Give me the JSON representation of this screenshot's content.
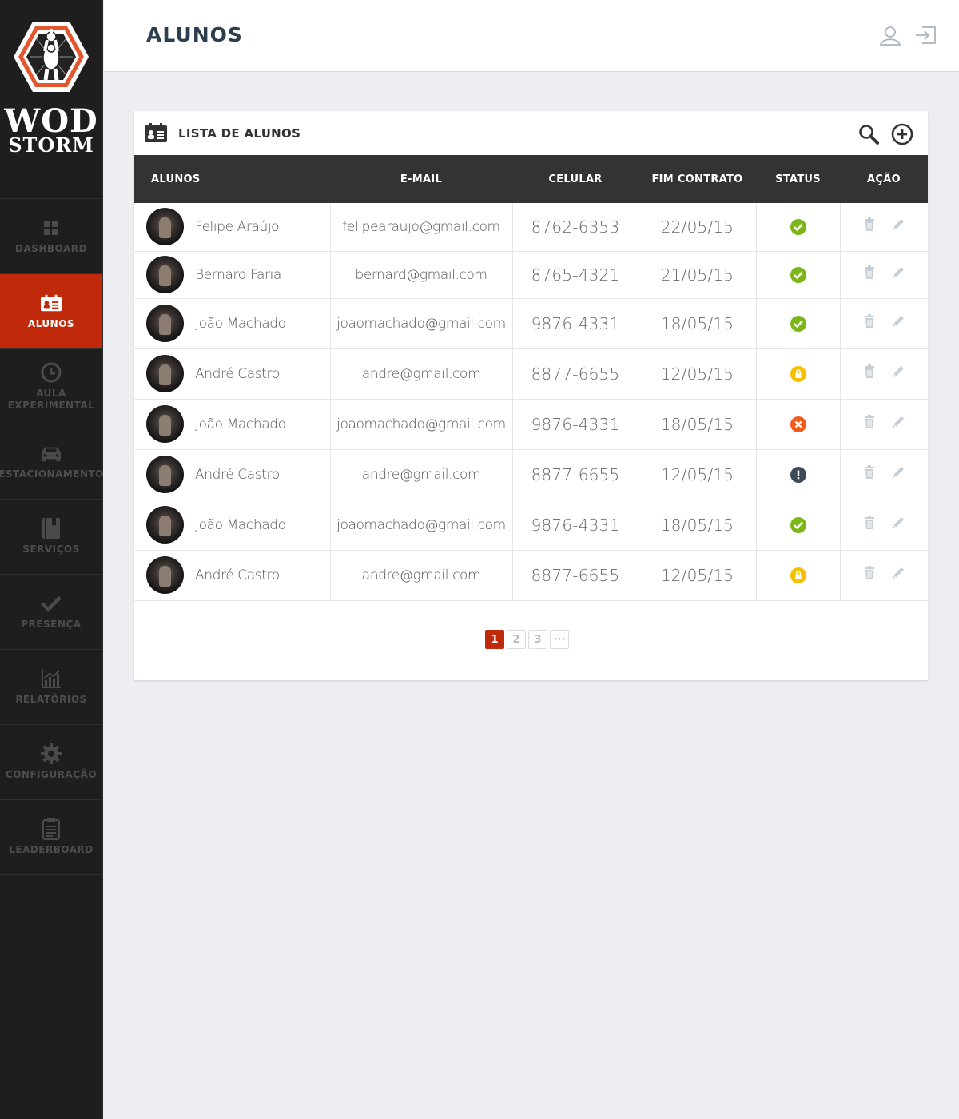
{
  "brand": {
    "line1": "WOD",
    "line2": "STORM"
  },
  "sidebar": {
    "items": [
      {
        "label": "DASHBOARD",
        "icon": "grid-icon"
      },
      {
        "label": "ALUNOS",
        "icon": "id-card-icon",
        "active": true
      },
      {
        "label": "AULA EXPERIMENTAL",
        "icon": "clock-icon"
      },
      {
        "label": "ESTACIONAMENTO",
        "icon": "car-icon"
      },
      {
        "label": "SERVIÇOS",
        "icon": "book-icon"
      },
      {
        "label": "PRESENÇA",
        "icon": "check-icon"
      },
      {
        "label": "RELATÓRIOS",
        "icon": "chart-icon"
      },
      {
        "label": "CONFIGURAÇÃO",
        "icon": "gear-icon"
      },
      {
        "label": "LEADERBOARD",
        "icon": "clipboard-icon"
      }
    ]
  },
  "header": {
    "title": "ALUNOS"
  },
  "card": {
    "title": "LISTA DE ALUNOS"
  },
  "table": {
    "columns": [
      "ALUNOS",
      "E-MAIL",
      "CELULAR",
      "FIM CONTRATO",
      "STATUS",
      "AÇÃO"
    ],
    "rows": [
      {
        "name": "Felipe Araújo",
        "email": "felipearaujo@gmail.com",
        "phone": "8762-6353",
        "end": "22/05/15",
        "status": "ok"
      },
      {
        "name": "Bernard Faria",
        "email": "bernard@gmail.com",
        "phone": "8765-4321",
        "end": "21/05/15",
        "status": "ok"
      },
      {
        "name": "João Machado",
        "email": "joaomachado@gmail.com",
        "phone": "9876-4331",
        "end": "18/05/15",
        "status": "ok"
      },
      {
        "name": "André Castro",
        "email": "andre@gmail.com",
        "phone": "8877-6655",
        "end": "12/05/15",
        "status": "locked"
      },
      {
        "name": "João Machado",
        "email": "joaomachado@gmail.com",
        "phone": "9876-4331",
        "end": "18/05/15",
        "status": "cancelled"
      },
      {
        "name": "André Castro",
        "email": "andre@gmail.com",
        "phone": "8877-6655",
        "end": "12/05/15",
        "status": "warning"
      },
      {
        "name": "João Machado",
        "email": "joaomachado@gmail.com",
        "phone": "9876-4331",
        "end": "18/05/15",
        "status": "ok"
      },
      {
        "name": "André Castro",
        "email": "andre@gmail.com",
        "phone": "8877-6655",
        "end": "12/05/15",
        "status": "locked"
      }
    ]
  },
  "pagination": {
    "pages": [
      "1",
      "2",
      "3",
      "···"
    ],
    "current": "1"
  },
  "colors": {
    "accent": "#c1290b",
    "ok": "#7cb518",
    "locked": "#f5c000",
    "cancelled": "#f05a1a",
    "warning": "#3d4a57"
  }
}
